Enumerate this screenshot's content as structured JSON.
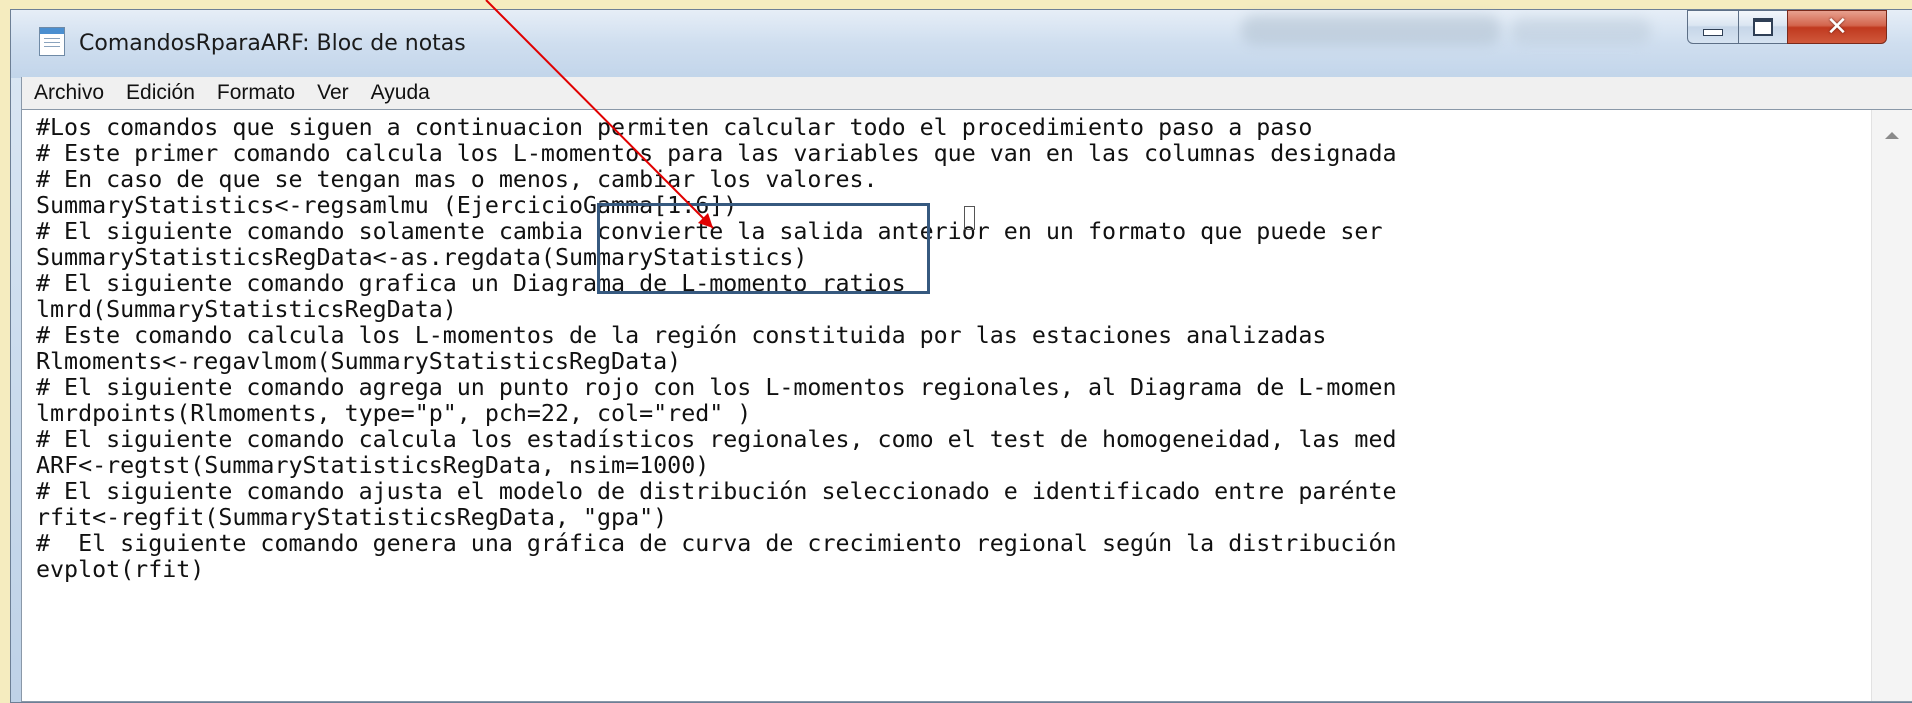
{
  "window": {
    "title": "ComandosRparaARF: Bloc de notas"
  },
  "menu": {
    "items": [
      "Archivo",
      "Edición",
      "Formato",
      "Ver",
      "Ayuda"
    ]
  },
  "editor": {
    "lines": [
      "#Los comandos que siguen a continuacion permiten calcular todo el procedimiento paso a paso",
      "# Este primer comando calcula los L-momentos para las variables que van en las columnas designada",
      "# En caso de que se tengan mas o menos, cambiar los valores.",
      "SummaryStatistics<-regsamlmu (EjercicioGamma[1:6])",
      "# El siguiente comando solamente cambia convierte la salida anterior en un formato que puede ser",
      "SummaryStatisticsRegData<-as.regdata(SummaryStatistics)",
      "# El siguiente comando grafica un Diagrama de L-momento ratios",
      "lmrd(SummaryStatisticsRegData)",
      "# Este comando calcula los L-momentos de la región constituida por las estaciones analizadas",
      "Rlmoments<-regavlmom(SummaryStatisticsRegData)",
      "# El siguiente comando agrega un punto rojo con los L-momentos regionales, al Diagrama de L-momen",
      "lmrdpoints(Rlmoments, type=\"p\", pch=22, col=\"red\" )",
      "# El siguiente comando calcula los estadísticos regionales, como el test de homogeneidad, las med",
      "ARF<-regtst(SummaryStatisticsRegData, nsim=1000)",
      "# El siguiente comando ajusta el modelo de distribución seleccionado e identificado entre parénte",
      "rfit<-regfit(SummaryStatisticsRegData, \"gpa\")",
      "#  El siguiente comando genera una gráfica de curva de crecimiento regional según la distribución",
      "evplot(rfit)"
    ]
  },
  "colors": {
    "background": "#f5ecbf",
    "annotation_arrow": "#e00000",
    "highlight_box": "#36597f"
  },
  "icons": {
    "app": "notepad-icon",
    "minimize": "minimize-icon",
    "maximize": "maximize-icon",
    "close": "close-icon"
  }
}
